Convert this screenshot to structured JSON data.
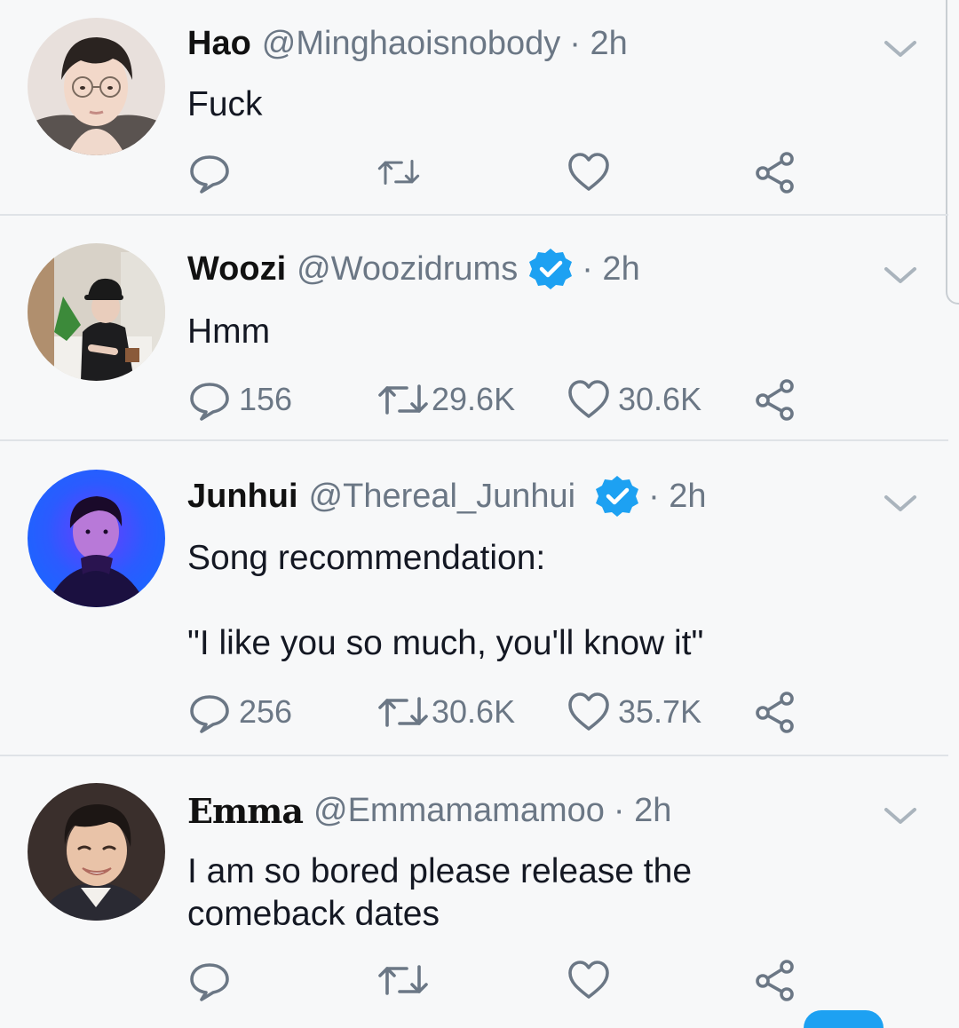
{
  "colors": {
    "background": "#f7f8f9",
    "text": "#141823",
    "secondary": "#6b7785",
    "verified": "#1da1f2",
    "divider": "#dfe3e7"
  },
  "tweets": [
    {
      "name": "Hao",
      "handle": "@Minghaoisnobody",
      "time": "· 2h",
      "verified": false,
      "text": "Fuck",
      "replies": "",
      "retweets": "",
      "likes": "",
      "avatar_icon": "avatar-hao"
    },
    {
      "name": "Woozi",
      "handle": "@Woozidrums",
      "time": "· 2h",
      "verified": true,
      "text": "Hmm",
      "replies": "156",
      "retweets": "29.6K",
      "likes": "30.6K",
      "avatar_icon": "avatar-woozi"
    },
    {
      "name": "Junhui",
      "handle": "@Thereal_Junhui",
      "time": "· 2h",
      "verified": true,
      "text": "Song recommendation:\n\n\"I like you so much, you'll know it\"",
      "replies": "256",
      "retweets": "30.6K",
      "likes": "35.7K",
      "avatar_icon": "avatar-junhui"
    },
    {
      "name": "Emma",
      "handle": "@Emmamamamoo",
      "time": "· 2h",
      "verified": false,
      "text": "I am so bored please release the\ncomeback dates",
      "replies": "",
      "retweets": "",
      "likes": "",
      "avatar_icon": "avatar-emma"
    }
  ],
  "icons": {
    "reply": "reply-icon",
    "retweet": "retweet-icon",
    "like": "heart-icon",
    "share": "share-icon",
    "more": "chevron-down-icon",
    "verified": "verified-badge-icon"
  }
}
